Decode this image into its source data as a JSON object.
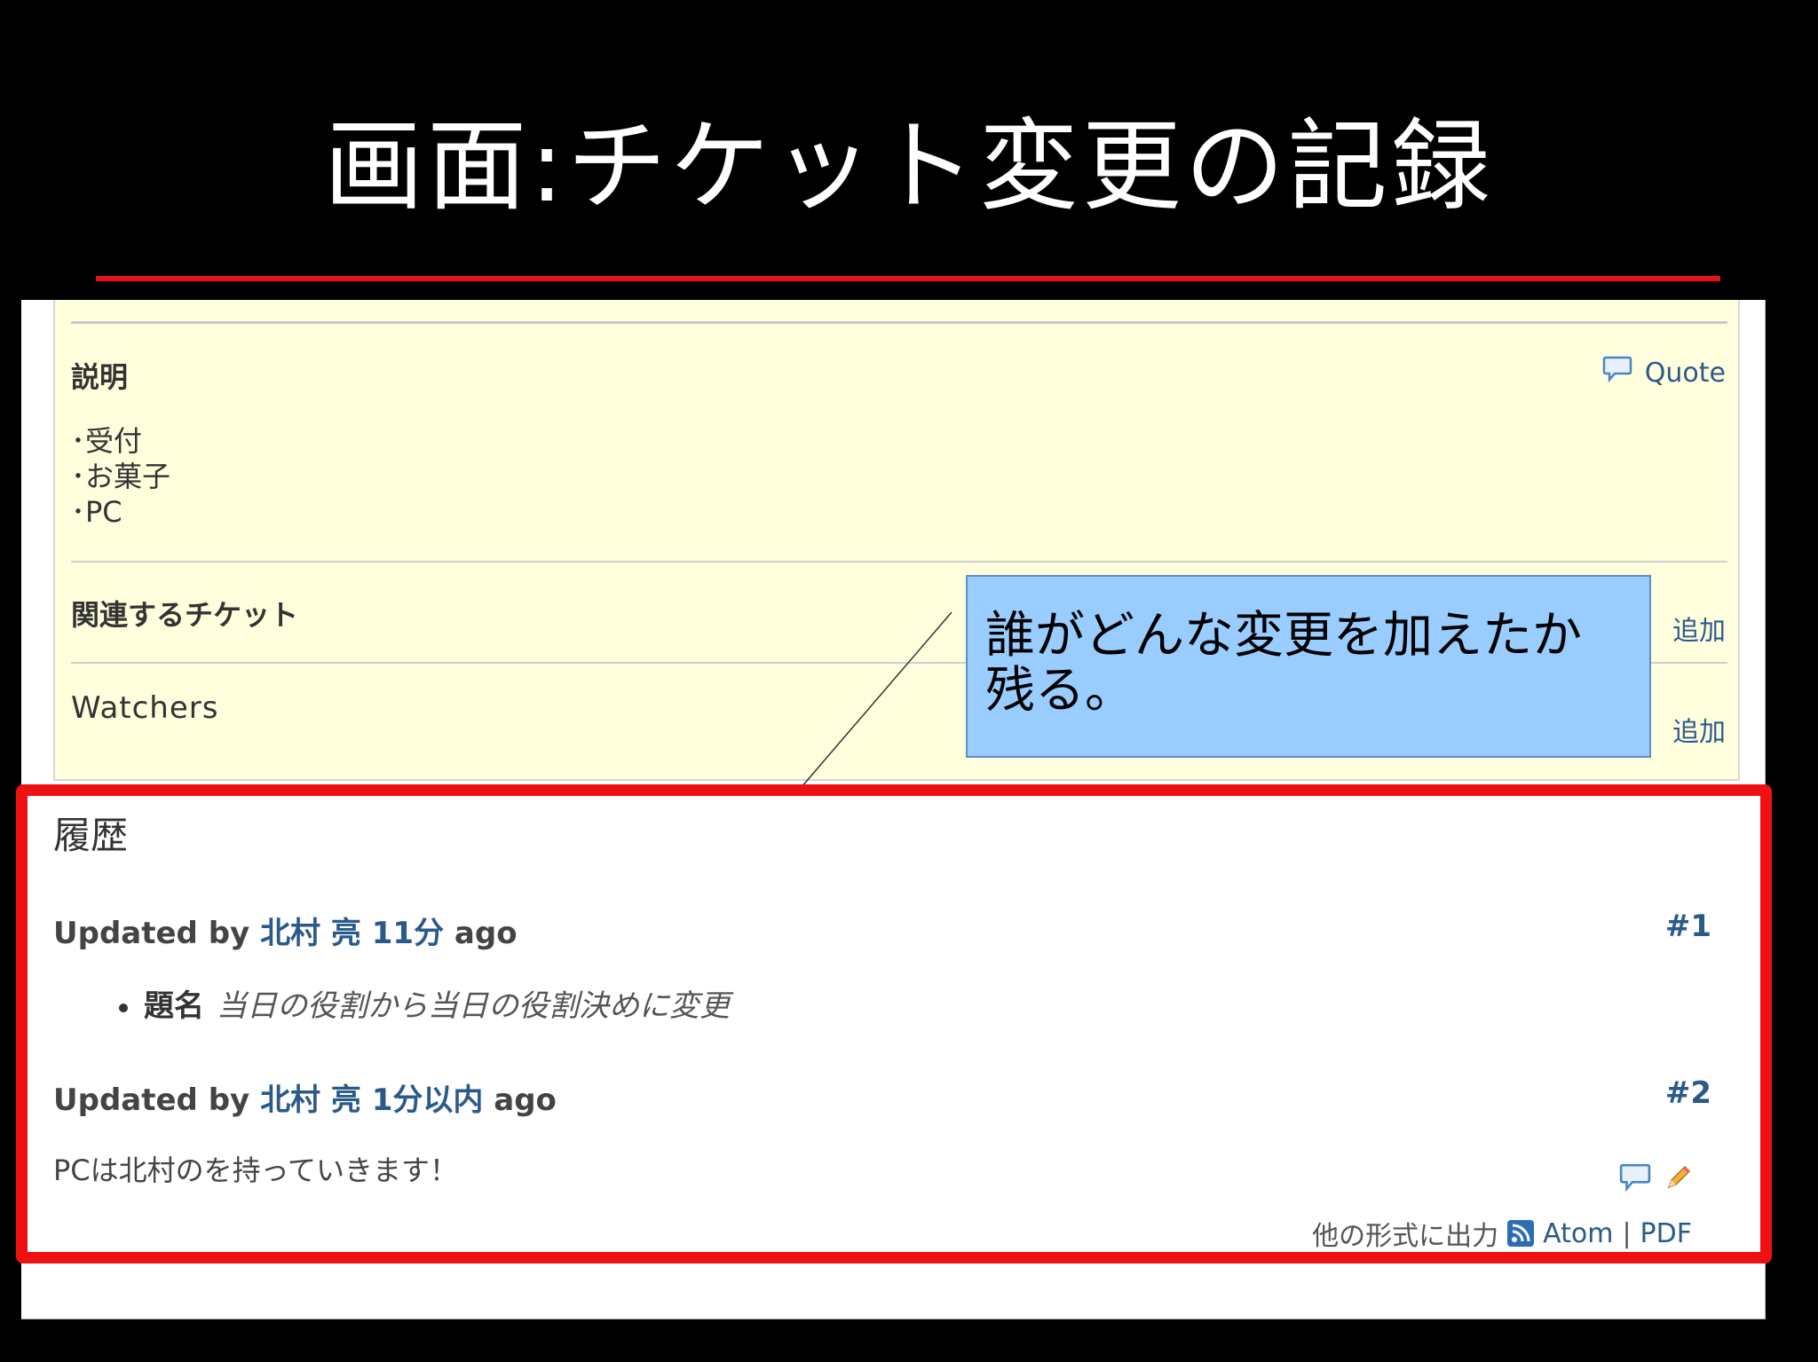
{
  "slide": {
    "title": "画面:チケット変更の記録"
  },
  "description": {
    "label": "説明",
    "quote_label": "Quote",
    "lines": [
      "･受付",
      "･お菓子",
      "･PC"
    ]
  },
  "related": {
    "label": "関連するチケット",
    "add_label": "追加"
  },
  "watchers": {
    "label": "Watchers",
    "add_label": "追加"
  },
  "callout": {
    "line1": "誰がどんな変更を加えたか",
    "line2": "残る。"
  },
  "history": {
    "title": "履歴",
    "journals": [
      {
        "prefix": "Updated by",
        "author": "北村 亮",
        "time": "11分",
        "suffix": "ago",
        "number": "#1",
        "field": "題名",
        "old_value": "当日の役割",
        "mid": "から",
        "new_value": "当日の役割決め",
        "end": "に変更"
      },
      {
        "prefix": "Updated by",
        "author": "北村 亮",
        "time": "1分以内",
        "suffix": "ago",
        "number": "#2",
        "note": "PCは北村のを持っていきます！"
      }
    ]
  },
  "export": {
    "label": "他の形式に出力",
    "atom": "Atom",
    "sep": "|",
    "pdf": "PDF"
  },
  "colors": {
    "highlight": "#ee1111",
    "callout_bg": "#99ccff",
    "issue_bg": "#ffffdd",
    "link": "#2a5a8a"
  }
}
